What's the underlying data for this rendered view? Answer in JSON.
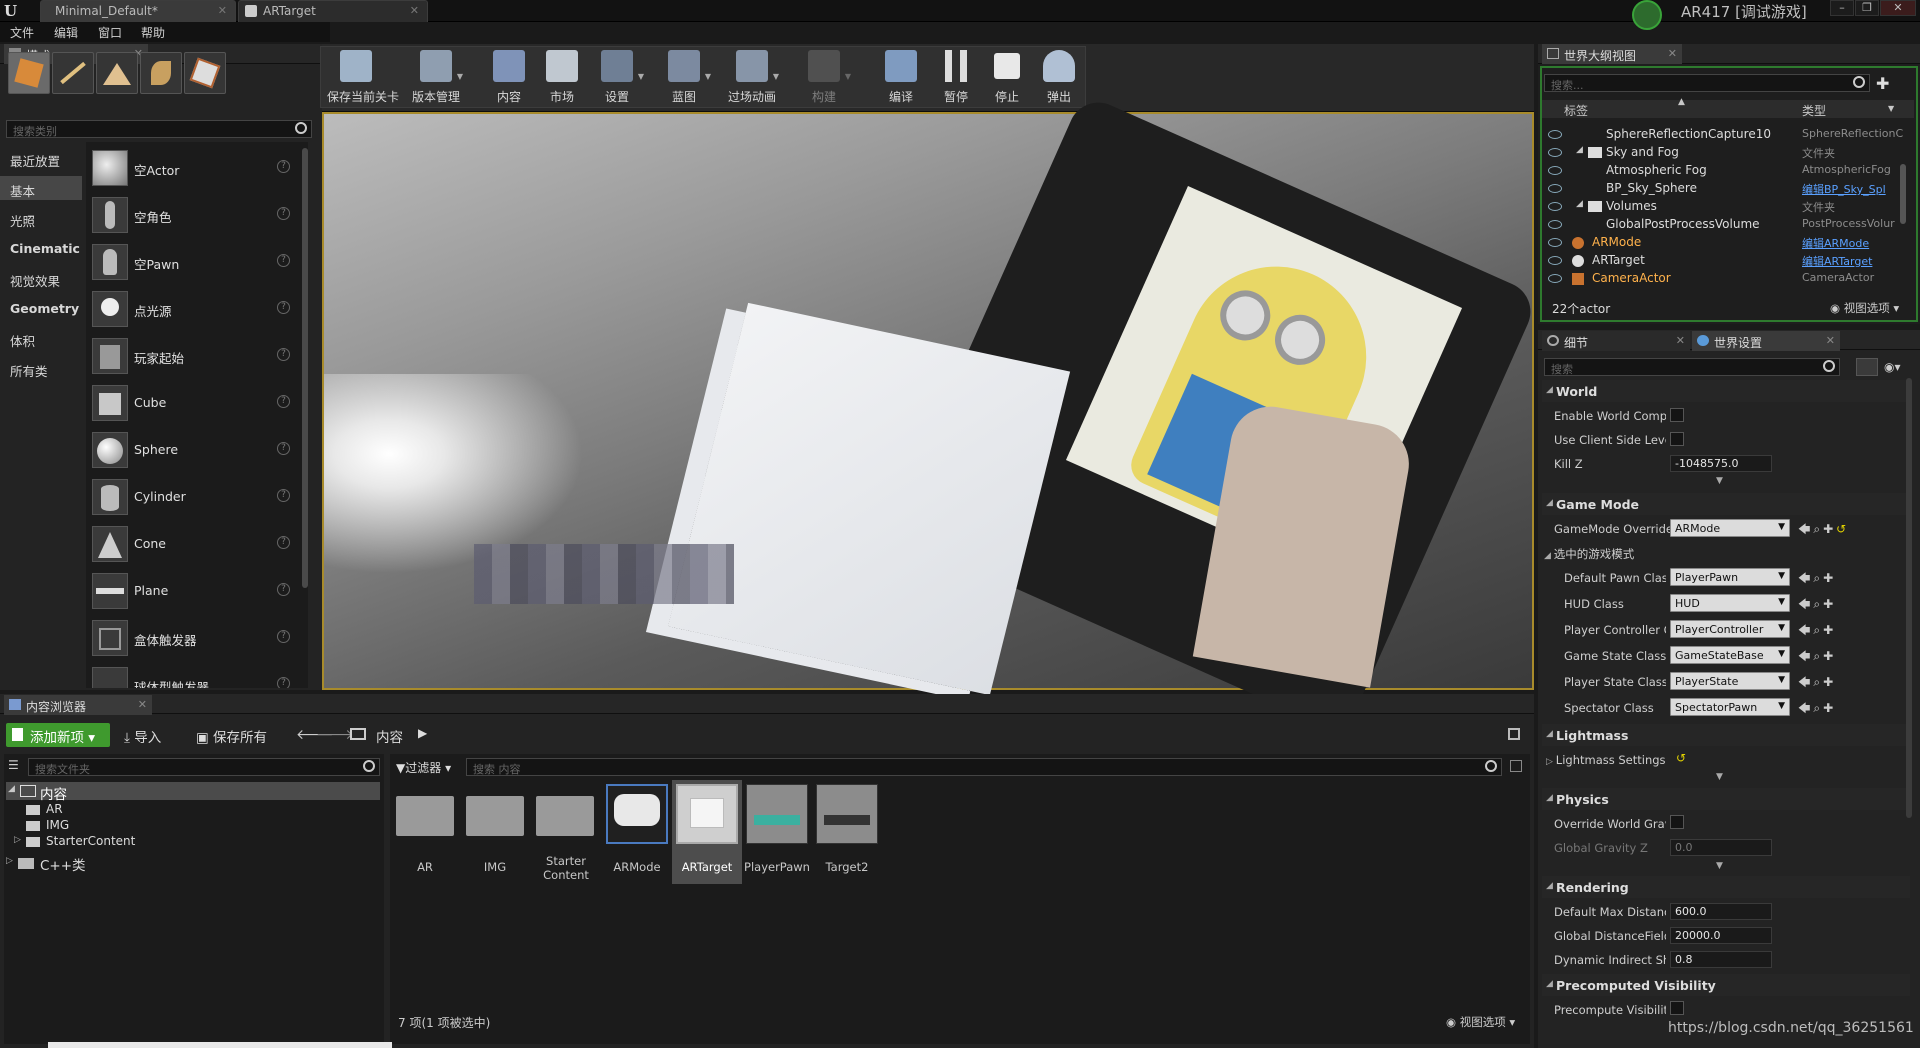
{
  "titlebar": {
    "tabs": [
      "Minimal_Default*",
      "ARTarget"
    ],
    "project": "AR417 [调试游戏]"
  },
  "menu": [
    "文件",
    "编辑",
    "窗口",
    "帮助"
  ],
  "modes": {
    "tab": "模式",
    "search_placeholder": "搜索类别",
    "categories": [
      "最近放置",
      "基本",
      "光照",
      "Cinematic",
      "视觉效果",
      "Geometry",
      "体积",
      "所有类"
    ],
    "selected_category": "基本",
    "items": [
      "空Actor",
      "空角色",
      "空Pawn",
      "点光源",
      "玩家起始",
      "Cube",
      "Sphere",
      "Cylinder",
      "Cone",
      "Plane",
      "盒体触发器",
      "球体型触发器"
    ]
  },
  "toolbar": {
    "buttons": [
      "保存当前关卡",
      "版本管理",
      "内容",
      "市场",
      "设置",
      "蓝图",
      "过场动画",
      "构建",
      "编译",
      "暂停",
      "停止",
      "弹出"
    ]
  },
  "outliner": {
    "tab": "世界大纲视图",
    "search_placeholder": "搜索...",
    "col_label": "标签",
    "col_type": "类型",
    "rows": [
      {
        "label": "SphereReflectionCapture10",
        "type": "SphereReflectionC"
      },
      {
        "label": "Sky and Fog",
        "type": "文件夹"
      },
      {
        "label": "Atmospheric Fog",
        "type": "AtmosphericFog"
      },
      {
        "label": "BP_Sky_Sphere",
        "type": "编辑BP_Sky_Spl"
      },
      {
        "label": "Volumes",
        "type": "文件夹"
      },
      {
        "label": "GlobalPostProcessVolume",
        "type": "PostProcessVolur"
      },
      {
        "label": "ARMode",
        "type": "编辑ARMode"
      },
      {
        "label": "ARTarget",
        "type": "编辑ARTarget"
      },
      {
        "label": "CameraActor",
        "type": "CameraActor"
      }
    ],
    "count": "22个actor",
    "view_options": "视图选项"
  },
  "details": {
    "tab1": "细节",
    "tab2": "世界设置",
    "search_placeholder": "搜索",
    "world": {
      "title": "World",
      "enable_world_comp": "Enable World Composi",
      "use_client_side": "Use Client Side Level",
      "kill_z_label": "Kill Z",
      "kill_z": "-1048575.0"
    },
    "game_mode": {
      "title": "Game Mode",
      "override_label": "GameMode Override",
      "override": "ARMode",
      "selected_label": "选中的游戏模式",
      "rows": [
        {
          "label": "Default Pawn Class",
          "value": "PlayerPawn"
        },
        {
          "label": "HUD Class",
          "value": "HUD"
        },
        {
          "label": "Player Controller Cl",
          "value": "PlayerController"
        },
        {
          "label": "Game State Class",
          "value": "GameStateBase"
        },
        {
          "label": "Player State Class",
          "value": "PlayerState"
        },
        {
          "label": "Spectator Class",
          "value": "SpectatorPawn"
        }
      ]
    },
    "lightmass": {
      "title": "Lightmass",
      "settings": "Lightmass Settings"
    },
    "physics": {
      "title": "Physics",
      "override_gravity": "Override World Gravity",
      "global_gravity_label": "Global Gravity Z",
      "global_gravity": "0.0"
    },
    "rendering": {
      "title": "Rendering",
      "rows": [
        {
          "label": "Default Max Distance",
          "value": "600.0"
        },
        {
          "label": "Global DistanceField V",
          "value": "20000.0"
        },
        {
          "label": "Dynamic Indirect Shac",
          "value": "0.8"
        }
      ]
    },
    "precomputed": {
      "title": "Precomputed Visibility",
      "label": "Precompute Visibility"
    }
  },
  "content": {
    "tab": "内容浏览器",
    "add_new": "添加新项",
    "import": "导入",
    "save_all": "保存所有",
    "path": "内容",
    "folder_search": "搜索文件夹",
    "filter": "过滤器",
    "content_search": "搜索 内容",
    "tree": [
      "内容",
      "AR",
      "IMG",
      "StarterContent",
      "C++类"
    ],
    "assets": [
      "AR",
      "IMG",
      "Starter Content",
      "ARMode",
      "ARTarget",
      "PlayerPawn",
      "Target2"
    ],
    "status": "7 项(1 项被选中)",
    "view_options": "视图选项"
  },
  "watermark": "https://blog.csdn.net/qq_36251561"
}
